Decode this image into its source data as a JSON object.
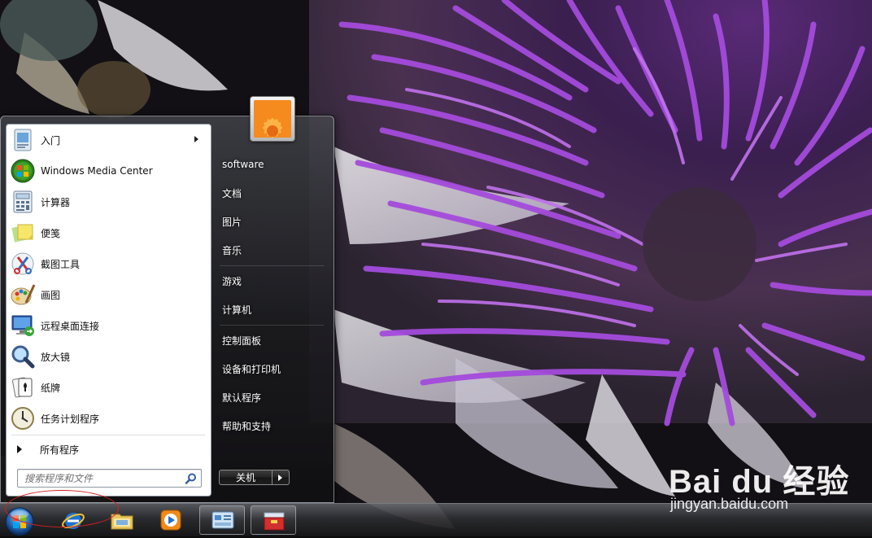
{
  "start_menu": {
    "programs": [
      {
        "label": "入门",
        "icon": "getting-started-icon",
        "has_submenu": true
      },
      {
        "label": "Windows Media Center",
        "icon": "windows-media-center-icon"
      },
      {
        "label": "计算器",
        "icon": "calculator-icon"
      },
      {
        "label": "便笺",
        "icon": "sticky-notes-icon"
      },
      {
        "label": "截图工具",
        "icon": "snipping-tool-icon"
      },
      {
        "label": "画图",
        "icon": "paint-icon"
      },
      {
        "label": "远程桌面连接",
        "icon": "remote-desktop-icon"
      },
      {
        "label": "放大镜",
        "icon": "magnifier-icon"
      },
      {
        "label": "纸牌",
        "icon": "solitaire-icon"
      },
      {
        "label": "任务计划程序",
        "icon": "task-scheduler-icon"
      }
    ],
    "all_programs_label": "所有程序",
    "search_placeholder": "搜索程序和文件",
    "right_items": [
      "software",
      "文档",
      "图片",
      "音乐",
      "游戏",
      "计算机",
      "控制面板",
      "设备和打印机",
      "默认程序",
      "帮助和支持"
    ],
    "shutdown_label": "关机",
    "user_picture": "flower-user-picture"
  },
  "taskbar": {
    "buttons": [
      "start-orb-icon",
      "internet-explorer-icon",
      "windows-explorer-icon",
      "media-player-icon",
      "control-panel-icon",
      "toolbox-icon"
    ]
  },
  "watermark": {
    "logo_text": "Bai  du 经验",
    "url": "jingyan.baidu.com"
  },
  "colors": {
    "annotation_circle": "#d22020",
    "flower_purple": "#9a3ed0"
  }
}
